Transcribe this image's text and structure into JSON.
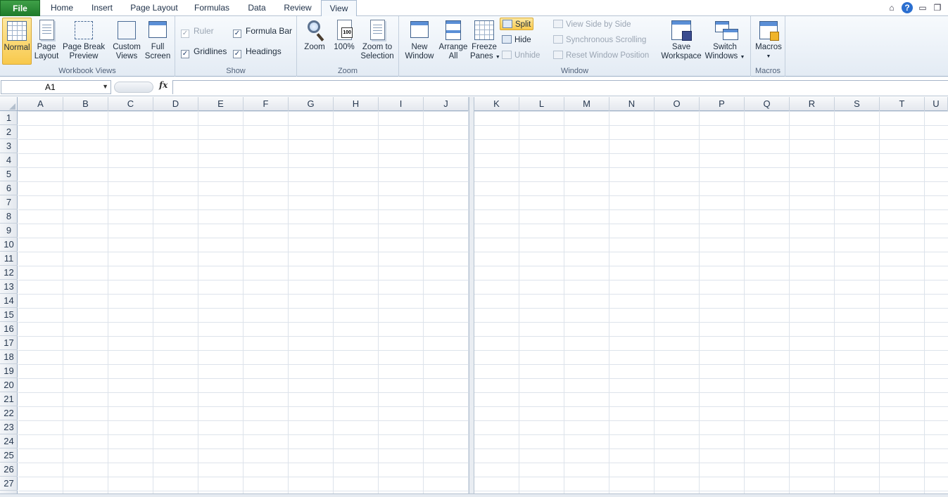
{
  "tabs": [
    {
      "id": "file",
      "label": "File"
    },
    {
      "id": "home",
      "label": "Home"
    },
    {
      "id": "insert",
      "label": "Insert"
    },
    {
      "id": "page_layout",
      "label": "Page Layout"
    },
    {
      "id": "formulas",
      "label": "Formulas"
    },
    {
      "id": "data",
      "label": "Data"
    },
    {
      "id": "review",
      "label": "Review"
    },
    {
      "id": "view",
      "label": "View"
    }
  ],
  "active_tab": "View",
  "ribbon": {
    "workbook_views": {
      "label": "Workbook Views",
      "normal": "Normal",
      "page_layout_1": "Page",
      "page_layout_2": "Layout",
      "page_break_1": "Page Break",
      "page_break_2": "Preview",
      "custom_1": "Custom",
      "custom_2": "Views",
      "full_1": "Full",
      "full_2": "Screen"
    },
    "show": {
      "label": "Show",
      "ruler": "Ruler",
      "formula_bar": "Formula Bar",
      "gridlines": "Gridlines",
      "headings": "Headings",
      "check_mark": "✓"
    },
    "zoom": {
      "label": "Zoom",
      "zoom": "Zoom",
      "hundred": "100%",
      "hundred_badge": "100",
      "to_sel_1": "Zoom to",
      "to_sel_2": "Selection"
    },
    "window": {
      "label": "Window",
      "new_1": "New",
      "new_2": "Window",
      "arrange_1": "Arrange",
      "arrange_2": "All",
      "freeze_1": "Freeze",
      "freeze_2": "Panes",
      "split": "Split",
      "hide": "Hide",
      "unhide": "Unhide",
      "side_by_side": "View Side by Side",
      "sync_scroll": "Synchronous Scrolling",
      "reset_pos": "Reset Window Position",
      "save_1": "Save",
      "save_2": "Workspace",
      "switch_1": "Switch",
      "switch_2": "Windows"
    },
    "macros": {
      "label": "Macros",
      "button": "Macros"
    }
  },
  "window_controls": {
    "minimize_ribbon": "⌂",
    "help": "?",
    "minimize": "▭",
    "restore": "❐"
  },
  "formula_bar": {
    "name_box": "A1",
    "fx": "fx",
    "dropdown": "▼",
    "formula": ""
  },
  "grid": {
    "left_columns": [
      "A",
      "B",
      "C",
      "D",
      "E",
      "F",
      "G",
      "H",
      "I",
      "J"
    ],
    "right_columns": [
      "K",
      "L",
      "M",
      "N",
      "O",
      "P",
      "Q",
      "R",
      "S",
      "T",
      "U"
    ],
    "rows": [
      "1",
      "2",
      "3",
      "4",
      "5",
      "6",
      "7",
      "8",
      "9",
      "10",
      "11",
      "12",
      "13",
      "14",
      "15",
      "16",
      "17",
      "18",
      "19",
      "20",
      "21",
      "22",
      "23",
      "24",
      "25",
      "26",
      "27"
    ]
  },
  "colors": {
    "file_tab": "#2a8c35",
    "selected_button": "#f8c94c",
    "ribbon_bg": "#e3ebf4"
  }
}
